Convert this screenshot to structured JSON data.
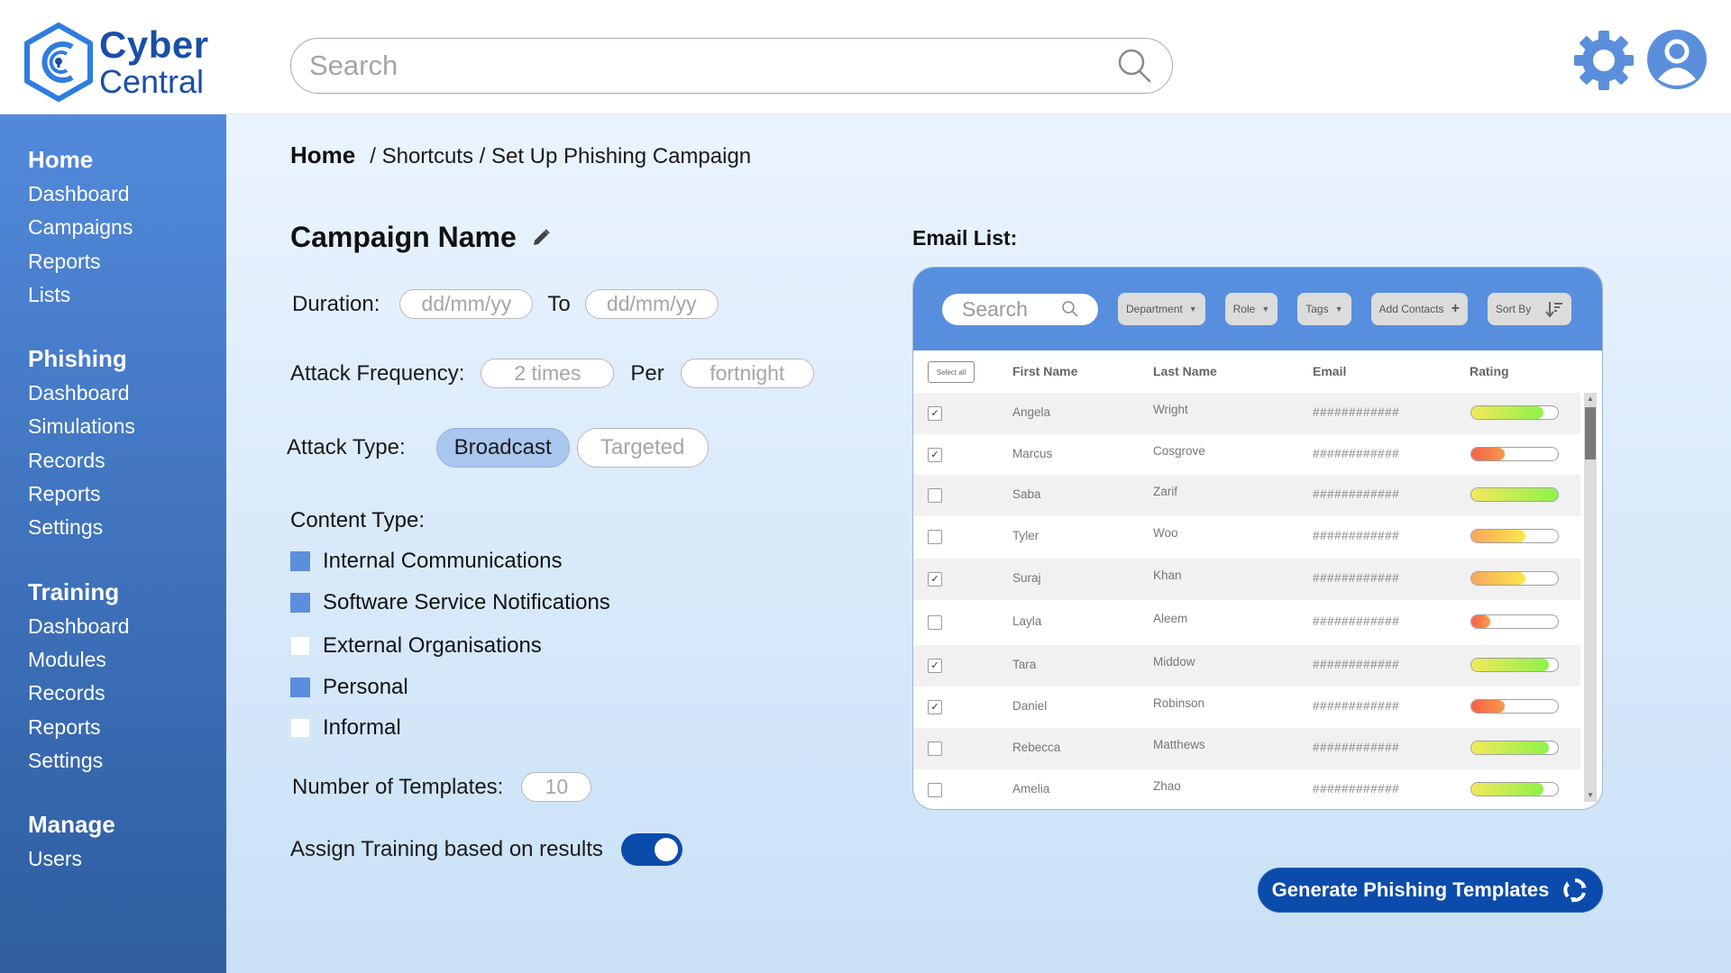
{
  "app": {
    "logo_line1": "Cyber",
    "logo_line2": "Central",
    "search_placeholder": "Search",
    "icons": {
      "search": "search-icon",
      "settings": "gear-icon",
      "profile": "user-avatar-icon"
    }
  },
  "colors": {
    "brand_dark": "#0b4bab",
    "brand_mid": "#588ede",
    "sidebar_top": "#5289db",
    "sidebar_bottom": "#2f5d9f",
    "checkbox_on": "#5b8fdc",
    "attack_type_active": "#a8c6ee"
  },
  "sidebar": {
    "groups": [
      {
        "title": "Home",
        "items": [
          "Dashboard",
          "Campaigns",
          "Reports",
          "Lists"
        ]
      },
      {
        "title": "Phishing",
        "items": [
          "Dashboard",
          "Simulations",
          "Records",
          "Reports",
          "Settings"
        ]
      },
      {
        "title": "Training",
        "items": [
          "Dashboard",
          "Modules",
          "Records",
          "Reports",
          "Settings"
        ]
      },
      {
        "title": "Manage",
        "items": [
          "Users"
        ]
      }
    ]
  },
  "breadcrumb": {
    "home": "Home",
    "rest": "/ Shortcuts / Set Up Phishing Campaign"
  },
  "form": {
    "campaign_name": "Campaign Name",
    "duration_label": "Duration:",
    "duration_from_placeholder": "dd/mm/yy",
    "duration_to_label": "To",
    "duration_to_placeholder": "dd/mm/yy",
    "frequency_label": "Attack Frequency:",
    "frequency_times": "2 times",
    "frequency_per_label": "Per",
    "frequency_period": "fortnight",
    "attack_type_label": "Attack Type:",
    "attack_types": [
      {
        "label": "Broadcast",
        "selected": true
      },
      {
        "label": "Targeted",
        "selected": false
      }
    ],
    "content_type_label": "Content Type:",
    "content_types": [
      {
        "label": "Internal Communications",
        "checked": true
      },
      {
        "label": "Software Service Notifications",
        "checked": true
      },
      {
        "label": "External Organisations",
        "checked": false
      },
      {
        "label": "Personal",
        "checked": true
      },
      {
        "label": "Informal",
        "checked": false
      }
    ],
    "templates_label": "Number of Templates:",
    "templates_value": "10",
    "assign_training_label": "Assign Training based on results",
    "assign_training_on": true
  },
  "email_list": {
    "title": "Email List:",
    "search_placeholder": "Search",
    "filters": {
      "department": "Department",
      "role": "Role",
      "tags": "Tags",
      "add_contacts": "Add Contacts",
      "sort_by": "Sort By"
    },
    "select_all": "Select all",
    "columns": [
      "First Name",
      "Last Name",
      "Email",
      "Rating"
    ],
    "rows": [
      {
        "first": "Angela",
        "last": "Wright",
        "email": "############",
        "rating": 0.83,
        "checked": true
      },
      {
        "first": "Marcus",
        "last": "Cosgrove",
        "email": "############",
        "rating": 0.39,
        "checked": true
      },
      {
        "first": "Saba",
        "last": "Zarif",
        "email": "############",
        "rating": 1.0,
        "checked": false
      },
      {
        "first": "Tyler",
        "last": "Woo",
        "email": "############",
        "rating": 0.63,
        "checked": false
      },
      {
        "first": "Suraj",
        "last": "Khan",
        "email": "############",
        "rating": 0.63,
        "checked": true
      },
      {
        "first": "Layla",
        "last": "Aleem",
        "email": "############",
        "rating": 0.22,
        "checked": false
      },
      {
        "first": "Tara",
        "last": "Middow",
        "email": "############",
        "rating": 0.9,
        "checked": true
      },
      {
        "first": "Daniel",
        "last": "Robinson",
        "email": "############",
        "rating": 0.39,
        "checked": true
      },
      {
        "first": "Rebecca",
        "last": "Matthews",
        "email": "############",
        "rating": 0.9,
        "checked": false
      },
      {
        "first": "Amelia",
        "last": "Zhao",
        "email": "############",
        "rating": 0.83,
        "checked": false
      }
    ]
  },
  "generate_button": "Generate Phishing Templates"
}
